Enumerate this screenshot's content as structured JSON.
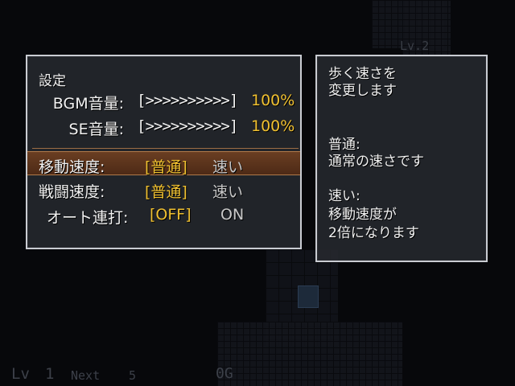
{
  "background": {
    "map_label": "Lv.2"
  },
  "settings": {
    "title": "設定",
    "bgm": {
      "label": "BGM音量:",
      "meter": "[>>>>>>>>>>]",
      "value": "100%",
      "level": 1.0
    },
    "se": {
      "label": "SE音量:",
      "meter": "[>>>>>>>>>>]",
      "value": "100%",
      "level": 1.0
    },
    "move_speed": {
      "label": "移動速度:",
      "option_selected": "[普通]",
      "option_other": "速い"
    },
    "battle_speed": {
      "label": "戦闘速度:",
      "option_selected": "[普通]",
      "option_other": "速い"
    },
    "auto_fire": {
      "label": "オート連打:",
      "option_selected": "[OFF]",
      "option_other": "ON"
    }
  },
  "help": {
    "line1": "歩く速さを",
    "line2": "変更します",
    "line3": "普通:",
    "line4": "通常の速さです",
    "line5": "速い:",
    "line6": "移動速度が",
    "line7": "2倍になります"
  },
  "hud": {
    "level_label": "Lv",
    "level_value": "1",
    "next_label": "Next",
    "next_value": "5",
    "gold": "0G"
  },
  "colors": {
    "highlight": "#f0c030",
    "selected_row": "#5a341c",
    "window_bg": "#26282e",
    "window_border": "#c9ccd2"
  }
}
